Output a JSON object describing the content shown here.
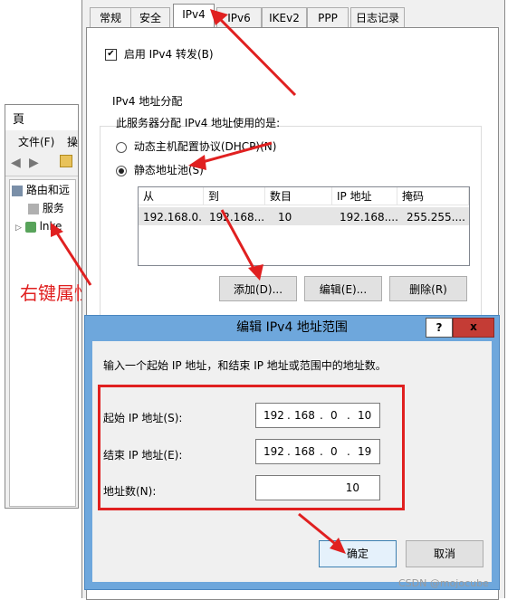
{
  "mmc": {
    "title": "頁",
    "menu_file": "文件(F)",
    "menu_cut": "操",
    "tree": [
      "路由和远",
      "服务",
      "lnke"
    ]
  },
  "props": {
    "tabs": [
      "常规",
      "安全",
      "IPv4",
      "IPv6",
      "IKEv2",
      "PPP",
      "日志记录"
    ],
    "enable_forwarding": "启用 IPv4 转发(B)",
    "group_title": "IPv4 地址分配",
    "group_desc": "此服务器分配 IPv4 地址使用的是:",
    "radio_dhcp": "动态主机配置协议(DHCP)(N)",
    "radio_static": "静态地址池(S)",
    "columns": [
      "从",
      "到",
      "数目",
      "IP 地址",
      "掩码"
    ],
    "row": [
      "192.168.0...",
      "192.168....",
      "10",
      "192.168....",
      "255.255...."
    ],
    "btn_add": "添加(D)...",
    "btn_edit": "编辑(E)...",
    "btn_delete": "删除(R)"
  },
  "annotation": "右键属性",
  "edit": {
    "title": "编辑 IPv4 地址范围",
    "help": "?",
    "close": "x",
    "instruction": "输入一个起始 IP 地址，和结束 IP 地址或范围中的地址数。",
    "start_label": "起始 IP 地址(S):",
    "start_ip": [
      "192",
      "168",
      "0",
      "10"
    ],
    "end_label": "结束 IP 地址(E):",
    "end_ip": [
      "192",
      "168",
      "0",
      "19"
    ],
    "count_label": "地址数(N):",
    "count_value": "10",
    "ok": "确定",
    "cancel": "取消"
  },
  "watermark": "CSDN @mojocube",
  "colors": {
    "annotation_red": "#e02020",
    "dialog_blue": "#6ea7dc"
  }
}
